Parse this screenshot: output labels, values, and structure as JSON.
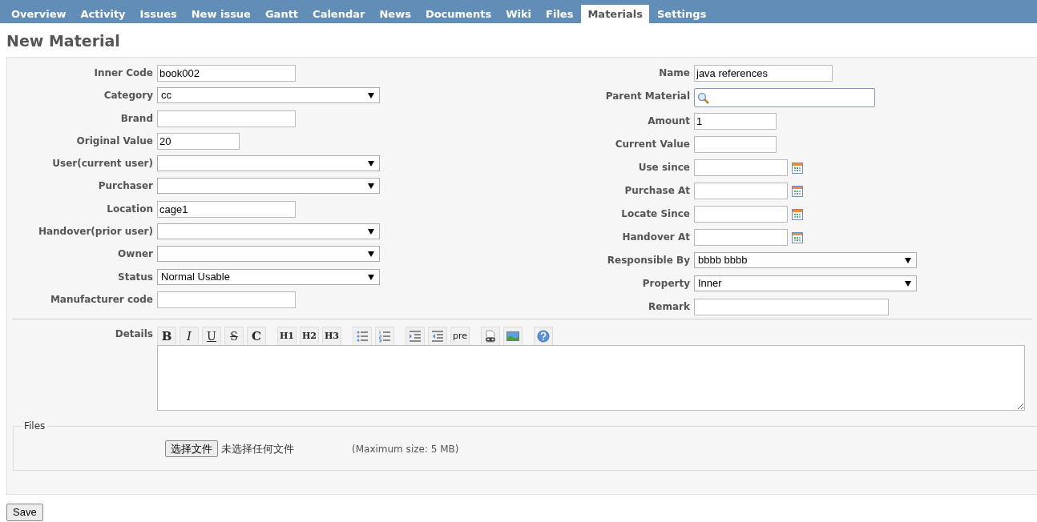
{
  "tabs": [
    {
      "label": "Overview",
      "selected": false
    },
    {
      "label": "Activity",
      "selected": false
    },
    {
      "label": "Issues",
      "selected": false
    },
    {
      "label": "New issue",
      "selected": false
    },
    {
      "label": "Gantt",
      "selected": false
    },
    {
      "label": "Calendar",
      "selected": false
    },
    {
      "label": "News",
      "selected": false
    },
    {
      "label": "Documents",
      "selected": false
    },
    {
      "label": "Wiki",
      "selected": false
    },
    {
      "label": "Files",
      "selected": false
    },
    {
      "label": "Materials",
      "selected": true
    },
    {
      "label": "Settings",
      "selected": false
    }
  ],
  "title": "New Material",
  "left_fields": [
    {
      "label": "Inner Code",
      "kind": "text",
      "value": "book002"
    },
    {
      "label": "Category",
      "kind": "select",
      "value": "cc"
    },
    {
      "label": "Brand",
      "kind": "text"
    },
    {
      "label": "Original Value",
      "kind": "number",
      "value": "20"
    },
    {
      "label": "User(current user)",
      "kind": "select"
    },
    {
      "label": "Purchaser",
      "kind": "select"
    },
    {
      "label": "Location",
      "kind": "text",
      "value": "cage1"
    },
    {
      "label": "Handover(prior user)",
      "kind": "select"
    },
    {
      "label": "Owner",
      "kind": "select"
    },
    {
      "label": "Status",
      "kind": "select",
      "value": "Normal Usable"
    },
    {
      "label": "Manufacturer code",
      "kind": "text"
    }
  ],
  "right_fields": [
    {
      "label": "Name",
      "kind": "text",
      "value": "java references"
    },
    {
      "label": "Parent Material",
      "kind": "search"
    },
    {
      "label": "Amount",
      "kind": "number",
      "value": "1"
    },
    {
      "label": "Current Value",
      "kind": "number"
    },
    {
      "label": "Use since",
      "kind": "date"
    },
    {
      "label": "Purchase At",
      "kind": "date"
    },
    {
      "label": "Locate Since",
      "kind": "date"
    },
    {
      "label": "Handover At",
      "kind": "date"
    },
    {
      "label": "Responsible By",
      "kind": "select",
      "value": "bbbb bbbb"
    },
    {
      "label": "Property",
      "kind": "select",
      "value": "Inner"
    },
    {
      "label": "Remark",
      "kind": "long"
    }
  ],
  "details": {
    "label": "Details",
    "toolbar": [
      [
        {
          "kind": "bold",
          "label": "B"
        },
        {
          "kind": "italic",
          "label": "I"
        },
        {
          "kind": "underline",
          "label": "U"
        },
        {
          "kind": "strike",
          "label": "S"
        },
        {
          "kind": "code",
          "label": "C"
        }
      ],
      [
        {
          "kind": "heading",
          "label": "H1"
        },
        {
          "kind": "heading",
          "label": "H2"
        },
        {
          "kind": "heading",
          "label": "H3"
        }
      ],
      [
        {
          "kind": "bullet-list"
        },
        {
          "kind": "numbered-list"
        }
      ],
      [
        {
          "kind": "indent"
        },
        {
          "kind": "outdent"
        },
        {
          "kind": "text",
          "label": "pre"
        }
      ],
      [
        {
          "kind": "link"
        },
        {
          "kind": "image"
        }
      ],
      [
        {
          "kind": "help"
        }
      ]
    ]
  },
  "files": {
    "legend": "Files",
    "choose_button": "选择文件",
    "no_file": "未选择任何文件",
    "max_size": "(Maximum size: 5 MB)"
  },
  "save_button": "Save"
}
